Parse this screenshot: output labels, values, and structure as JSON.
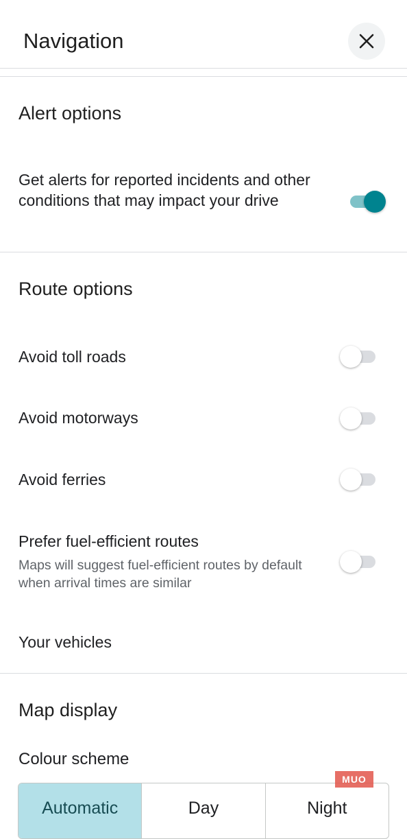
{
  "header": {
    "title": "Navigation",
    "close_icon": "close-icon"
  },
  "alert_options": {
    "title": "Alert options",
    "incidents": {
      "label": "Get alerts for reported incidents and other conditions that may impact your drive",
      "enabled": true
    }
  },
  "route_options": {
    "title": "Route options",
    "items": [
      {
        "label": "Avoid toll roads",
        "enabled": false
      },
      {
        "label": "Avoid motorways",
        "enabled": false
      },
      {
        "label": "Avoid ferries",
        "enabled": false
      },
      {
        "label": "Prefer fuel-efficient routes",
        "description": "Maps will suggest fuel-efficient routes by default when arrival times are similar",
        "enabled": false
      }
    ],
    "vehicles_label": "Your vehicles"
  },
  "map_display": {
    "title": "Map display",
    "colour_scheme_label": "Colour scheme",
    "options": [
      "Automatic",
      "Day",
      "Night"
    ],
    "selected": "Automatic"
  },
  "watermark": "MUO",
  "colors": {
    "accent": "#00838f",
    "accent_track": "#7fc2c8",
    "selected_segment": "#b3e0e8"
  }
}
